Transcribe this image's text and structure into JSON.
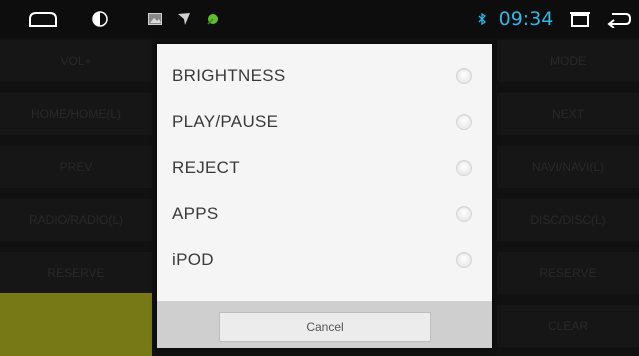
{
  "status_bar": {
    "time": "09:34",
    "icons": [
      "home-icon",
      "brightness-icon",
      "image-icon",
      "navigation-icon",
      "leaf-icon",
      "bluetooth-icon",
      "recent-apps-icon",
      "back-icon"
    ],
    "clock_color": "#33b5e5"
  },
  "background_keys": {
    "left": [
      "VOL+",
      "HOME/HOME(L)",
      "PREV",
      "RADIO/RADIO(L)",
      "RESERVE",
      ""
    ],
    "right": [
      "MODE",
      "NEXT",
      "NAVI/NAVI(L)",
      "DISC/DISC(L)",
      "RESERVE",
      "CLEAR"
    ]
  },
  "dialog": {
    "options": [
      "BRIGHTNESS",
      "PLAY/PAUSE",
      "REJECT",
      "APPS",
      "iPOD"
    ],
    "cancel_label": "Cancel"
  },
  "colors": {
    "accent": "#33b5e5",
    "highlight_key": "#b5ba23"
  }
}
